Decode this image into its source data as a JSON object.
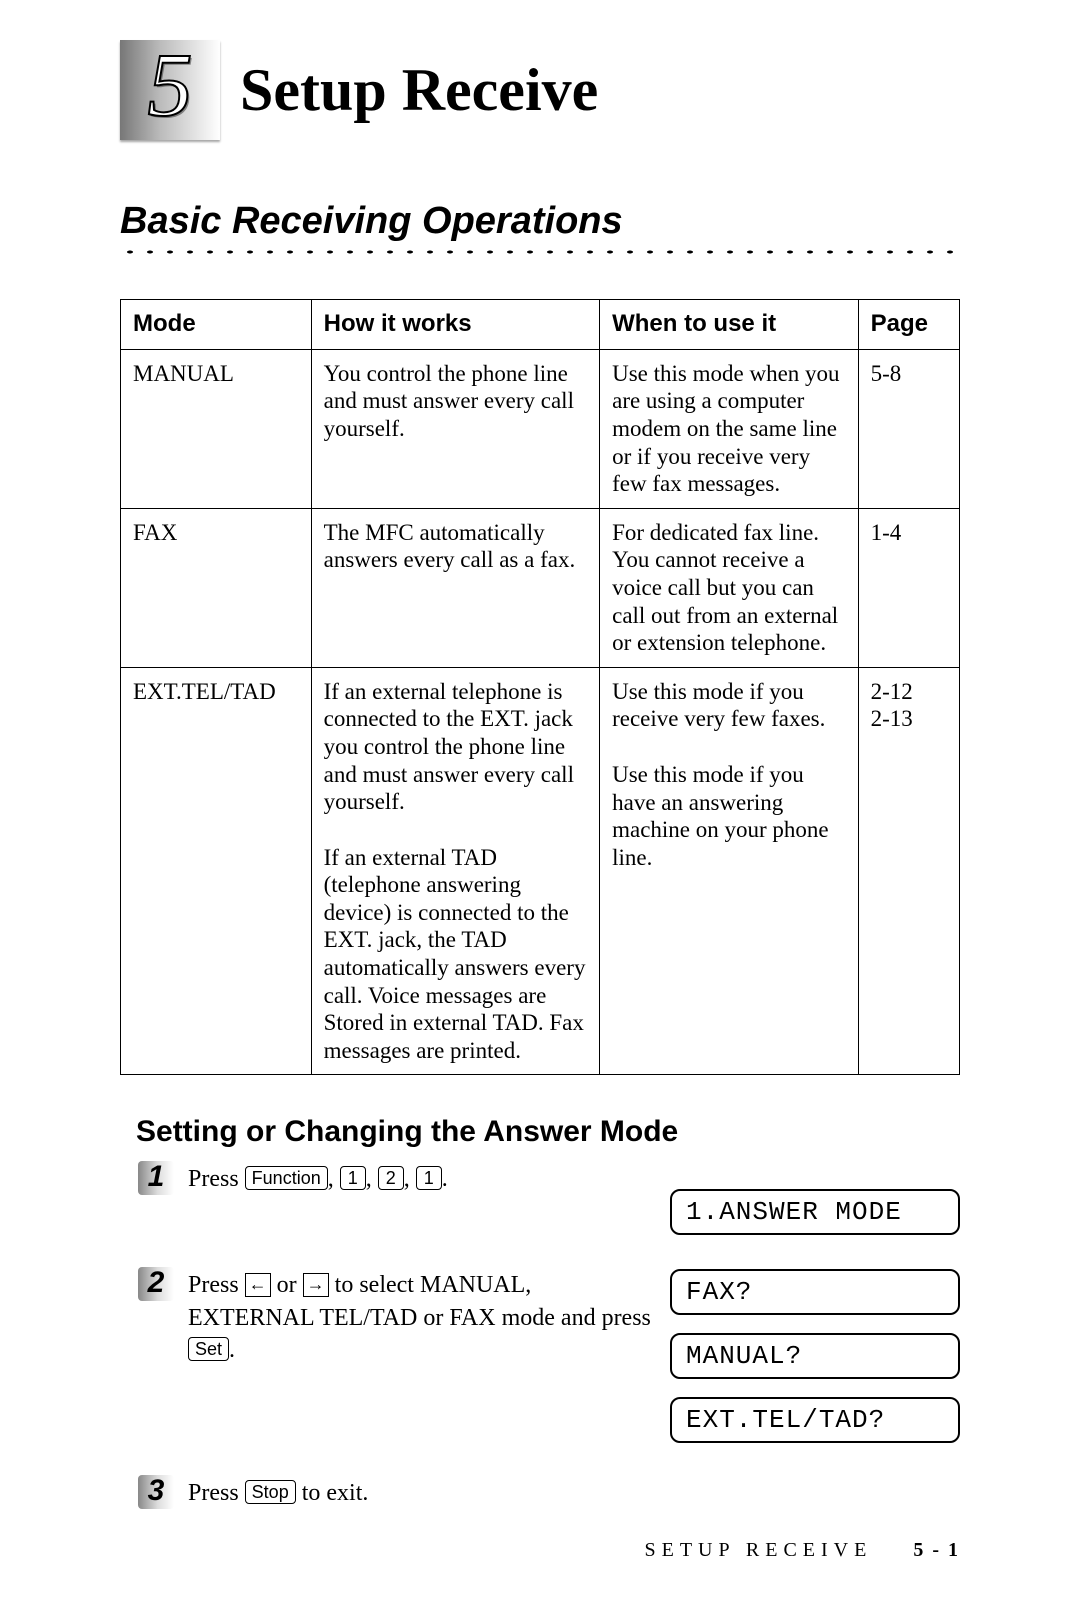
{
  "chapter": {
    "number": "5",
    "title": "Setup Receive"
  },
  "section_title": "Basic Receiving Operations",
  "table": {
    "headers": {
      "mode": "Mode",
      "how": "How it works",
      "when": "When to use it",
      "page": "Page"
    },
    "rows": [
      {
        "mode": "MANUAL",
        "how": "You control the phone line and must answer every call yourself.",
        "when": "Use this mode when you are using a computer modem on the same line or if you receive very few fax messages.",
        "page": "5-8"
      },
      {
        "mode": "FAX",
        "how": "The MFC automatically answers every call as a fax.",
        "when": "For dedicated fax line. You cannot receive a voice call but you can call out from an external or extension telephone.",
        "page": "1-4"
      },
      {
        "mode": "EXT.TEL/TAD",
        "how_a": "If an external telephone is connected to the EXT. jack you control the phone line and must answer every call yourself.",
        "when_a": "Use this mode if you receive very few faxes.",
        "how_b": "If an external TAD (telephone answering device) is connected to the EXT. jack, the TAD automatically answers every call. Voice messages are Stored in external TAD. Fax messages are printed.",
        "when_b": "Use this mode if you have an answering machine on your phone line.",
        "page": "2-12\n2-13"
      }
    ]
  },
  "sub_heading": "Setting or Changing the Answer Mode",
  "steps": {
    "s1": {
      "num": "1",
      "pre": "Press ",
      "keys": {
        "func": "Function",
        "k1": "1",
        "k2": "2",
        "k3": "1"
      },
      "lcd": "1.ANSWER MODE"
    },
    "s2": {
      "num": "2",
      "t1": "Press ",
      "t_or": " or ",
      "t2": " to select MANUAL, EXTERNAL TEL/TAD or FAX mode and press ",
      "key_set": "Set",
      "lcd1": "FAX?",
      "lcd2": "MANUAL?",
      "lcd3": "EXT.TEL/TAD?"
    },
    "s3": {
      "num": "3",
      "t1": "Press ",
      "key_stop": "Stop",
      "t2": " to exit."
    }
  },
  "footer": {
    "label": "SETUP RECEIVE",
    "page": "5 - 1"
  }
}
